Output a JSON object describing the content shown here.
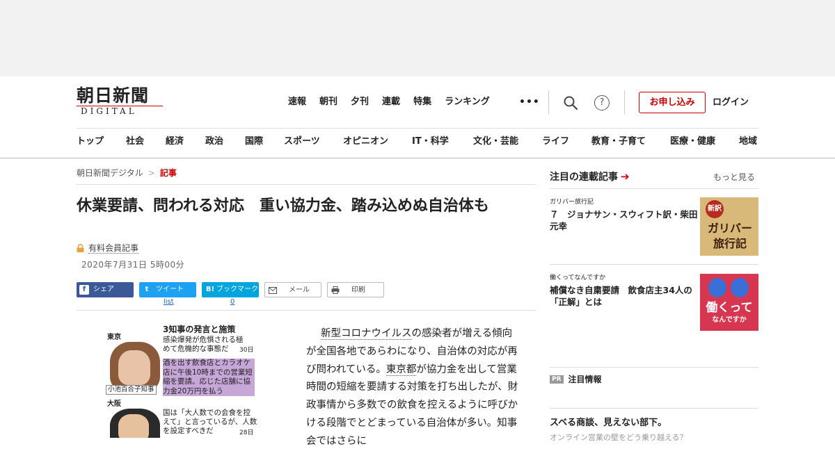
{
  "header": {
    "logo_kanji": "朝日新聞",
    "logo_sub": "DIGITAL",
    "top_nav": [
      "速報",
      "朝刊",
      "夕刊",
      "連載",
      "特集",
      "ランキング"
    ],
    "more_icon": "•••",
    "help_icon": "?",
    "apply_label": "お申し込み",
    "login_label": "ログイン",
    "sub_nav": [
      "トップ",
      "社会",
      "経済",
      "政治",
      "国際",
      "スポーツ",
      "オピニオン",
      "IT・科学",
      "文化・芸能",
      "ライフ",
      "教育・子育て",
      "医療・健康",
      "地域"
    ]
  },
  "breadcrumb": {
    "home": "朝日新聞デジタル",
    "sep": ">",
    "current": "記事"
  },
  "article": {
    "title": "休業要請、問われる対応　重い協力金、踏み込めぬ自治体も",
    "member_label": "有料会員記事",
    "date": "2020年7月31日 5時00分",
    "share": {
      "facebook_icon": "f",
      "facebook": "シェア",
      "twitter_icon": "t",
      "twitter": "ツイート",
      "twitter_count": "list",
      "hatena_icon": "B!",
      "hatena": "ブックマーク",
      "hatena_count": "0",
      "mail": "メール",
      "print": "印刷"
    },
    "photo": {
      "title": "3知事の発言と施策",
      "city1": "東京",
      "quote1": [
        "感染爆発が危惧される極",
        "めて危機的な事態だ"
      ],
      "day1": "30日",
      "highlight1": "酒を出す飲食店とカラオケ店に午後10時までの営業短縮を要請。応じた店舗に協力金20万円を払う",
      "name1": "小池百合子知事",
      "city2": "大阪",
      "quote2": [
        "国は「大人数での会食を控",
        "えて」と言っているが、人数",
        "を設定すべきだ"
      ],
      "day2": "28日"
    },
    "body": {
      "link1": "新型コロナウイルス",
      "part1": "の感染者が増える傾向が全国各地であらわになり、自治体の対応が再び問われている。",
      "link2": "東京都",
      "part2": "が協力金を出して営業時間の短縮を要請する対策を打ち出したが、財政事情から多数での飲食を控えるように呼びかける段階でとどまっている自治体が多い。知事会ではさらに"
    }
  },
  "sidebar": {
    "heading": "注目の連載記事",
    "heading_arrow": "➔",
    "more": "もっと見る",
    "items": [
      {
        "category": "ガリバー旅行記",
        "title": "７　ジョナサン・スウィフト訳・柴田元幸",
        "thumb_badge": "新訳",
        "thumb_text": "ガリバー旅行記"
      },
      {
        "category": "働くってなんですか",
        "title": "補償なき自粛要請　飲食店主34人の「正解」とは",
        "thumb_text": "働くって",
        "thumb_sub": "なんですか"
      }
    ],
    "pr_badge": "PR",
    "pr_label": "注目情報",
    "promo_title": "スベる商談、見えない部下。",
    "promo_sub": "オンライン営業の壁をどう乗り越える？"
  },
  "colors": {
    "accent": "#cc0000",
    "facebook": "#3b5998",
    "twitter": "#1da1f2",
    "hatena": "#00a4de"
  }
}
